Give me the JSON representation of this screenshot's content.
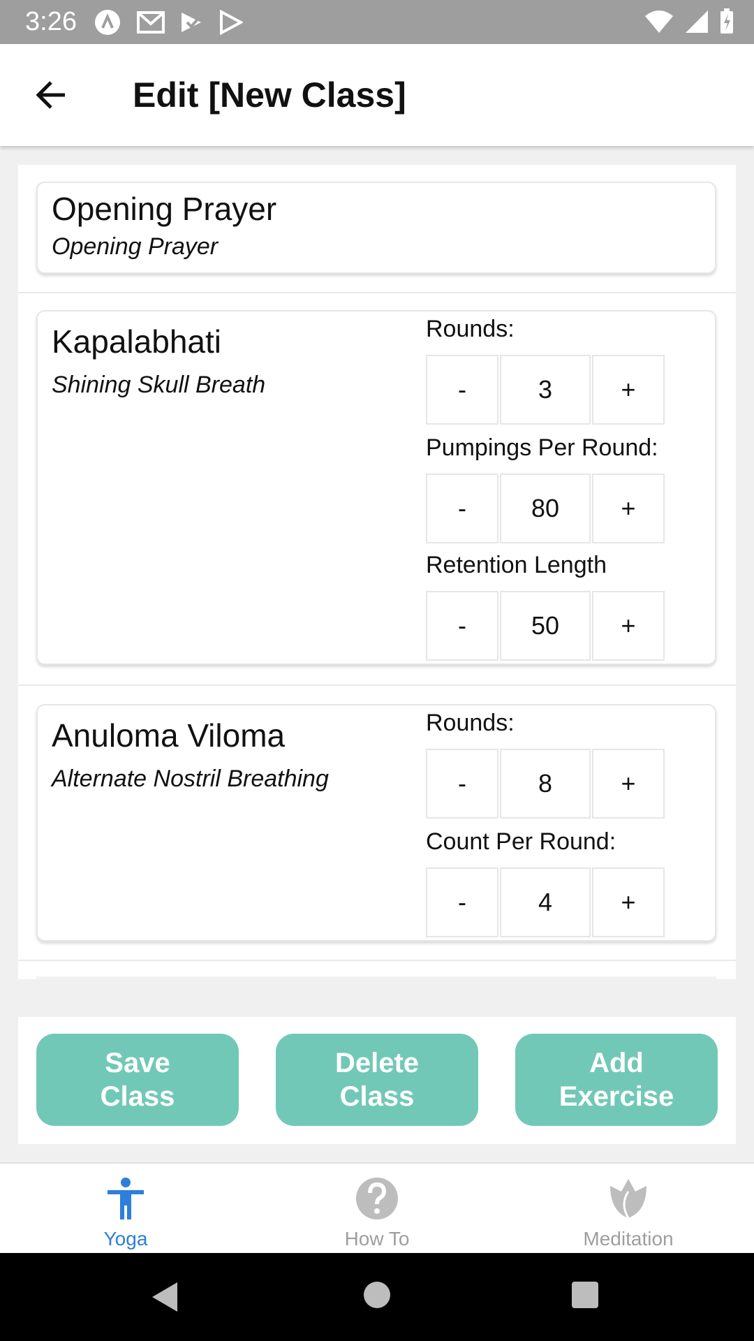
{
  "status_bar": {
    "time": "3:26",
    "left_icons": [
      "app-icon",
      "gmail-icon",
      "task-icon",
      "play-store-icon"
    ],
    "right_icons": [
      "wifi-icon",
      "signal-icon",
      "battery-icon"
    ]
  },
  "header": {
    "title": "Edit [New Class]",
    "back_icon": "arrow-back-icon"
  },
  "exercises": [
    {
      "name": "Opening Prayer",
      "subtitle": "Opening Prayer",
      "params": []
    },
    {
      "name": "Kapalabhati",
      "subtitle": "Shining Skull Breath",
      "params": [
        {
          "label": "Rounds:",
          "minus": "-",
          "value": "3",
          "plus": "+"
        },
        {
          "label": "Pumpings Per Round:",
          "minus": "-",
          "value": "80",
          "plus": "+"
        },
        {
          "label": "Retention Length",
          "minus": "-",
          "value": "50",
          "plus": "+"
        }
      ]
    },
    {
      "name": "Anuloma Viloma",
      "subtitle": "Alternate Nostril Breathing",
      "params": [
        {
          "label": "Rounds:",
          "minus": "-",
          "value": "8",
          "plus": "+"
        },
        {
          "label": "Count Per Round:",
          "minus": "-",
          "value": "4",
          "plus": "+"
        }
      ]
    }
  ],
  "actions": {
    "save": "Save\nClass",
    "delete": "Delete\nClass",
    "add": "Add\nExercise",
    "color": "#72c8b6"
  },
  "bottom_nav": {
    "items": [
      {
        "label": "Yoga",
        "icon": "person-yoga-icon",
        "active": true
      },
      {
        "label": "How To",
        "icon": "help-circle-icon",
        "active": false
      },
      {
        "label": "Meditation",
        "icon": "lotus-icon",
        "active": false
      }
    ],
    "active_color": "#2d7fd9"
  },
  "system_nav": [
    "back-triangle-icon",
    "home-circle-icon",
    "recents-square-icon"
  ]
}
